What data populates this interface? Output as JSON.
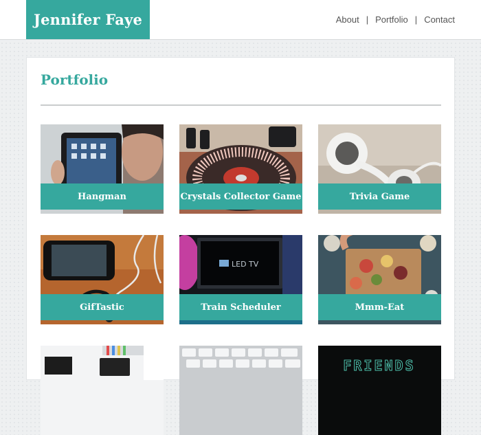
{
  "brand": {
    "name": "Jennifer Faye",
    "accent": "#36a89e"
  },
  "nav": {
    "items": [
      "About",
      "Portfolio",
      "Contact"
    ],
    "separator": "|"
  },
  "page": {
    "title": "Portfolio"
  },
  "projects": [
    {
      "title": "Hangman",
      "icon": "tablet-photo"
    },
    {
      "title": "Crystals Collector Game",
      "icon": "turntable-photo"
    },
    {
      "title": "Trivia Game",
      "icon": "earbuds-photo"
    },
    {
      "title": "GifTastic",
      "icon": "phone-earphones-photo"
    },
    {
      "title": "Train Scheduler",
      "icon": "led-tv-photo"
    },
    {
      "title": "Mmm-Eat",
      "icon": "food-board-photo"
    },
    {
      "title": "",
      "icon": "desk-laptop-photo"
    },
    {
      "title": "",
      "icon": "keyboard-photo"
    },
    {
      "title": "",
      "icon": "friends-sign-photo"
    }
  ],
  "images": {
    "tv_screen_text": "LED TV",
    "sign_text": "FRIENDS"
  }
}
